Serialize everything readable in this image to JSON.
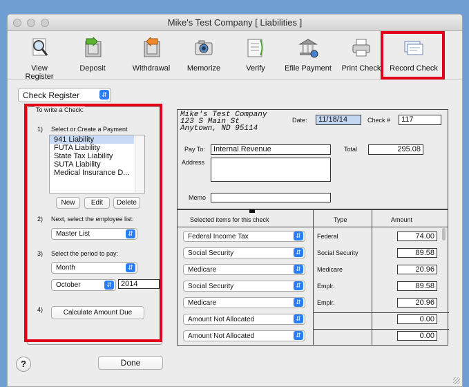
{
  "window": {
    "title": "Mike's Test Company [ Liabilities ]"
  },
  "toolbar": {
    "view_register": "View Register",
    "deposit": "Deposit",
    "withdrawal": "Withdrawal",
    "memorize": "Memorize",
    "verify": "Verify",
    "efile_payment": "Efile Payment",
    "print_check": "Print Check",
    "record_check": "Record Check"
  },
  "register_select": "Check Register",
  "left": {
    "group_title": "To write a Check:",
    "step1_num": "1)",
    "step1_label": "Select or Create a Payment",
    "payments": [
      "941 Liability",
      "FUTA Liability",
      "State Tax Liability",
      "SUTA Liability",
      "Medical Insurance D..."
    ],
    "new_btn": "New",
    "edit_btn": "Edit",
    "delete_btn": "Delete",
    "step2_num": "2)",
    "step2_label": "Next, select the employee list:",
    "employee_list": "Master List",
    "step3_num": "3)",
    "step3_label": "Select the period to pay:",
    "period_type": "Month",
    "period_month": "October",
    "period_year": "2014",
    "step4_num": "4)",
    "calculate_btn": "Calculate Amount Due"
  },
  "check": {
    "company_line1": "Mike's Test Company",
    "company_line2": "123 S Main St",
    "company_line3": "Anytown, ND  95114",
    "date_label": "Date:",
    "date_value": "11/18/14",
    "checknum_label": "Check #",
    "checknum_value": "117",
    "payto_label": "Pay To:",
    "payto_value": "Internal Revenue",
    "total_label": "Total",
    "total_value": "295.08",
    "address_label": "Address",
    "memo_label": "Memo"
  },
  "items": {
    "col_items": "Selected items for this check",
    "col_type": "Type",
    "col_amount": "Amount",
    "rows": [
      {
        "item": "Federal Income Tax",
        "type": "Federal",
        "amount": "74.00"
      },
      {
        "item": "Social Security",
        "type": "Social Security",
        "amount": "89.58"
      },
      {
        "item": "Medicare",
        "type": "Medicare",
        "amount": "20.96"
      },
      {
        "item": "Social Security",
        "type": "Emplr.",
        "amount": "89.58"
      },
      {
        "item": "Medicare",
        "type": "Emplr.",
        "amount": "20.96"
      },
      {
        "item": "Amount Not Allocated",
        "type": "",
        "amount": "0.00"
      },
      {
        "item": "Amount Not Allocated",
        "type": "",
        "amount": "0.00"
      }
    ]
  },
  "help_label": "?",
  "done_btn": "Done",
  "colors": {
    "highlight_red": "#e3001b",
    "select_blue": "#2b7ef5",
    "background_blue": "#6f9fd2"
  }
}
